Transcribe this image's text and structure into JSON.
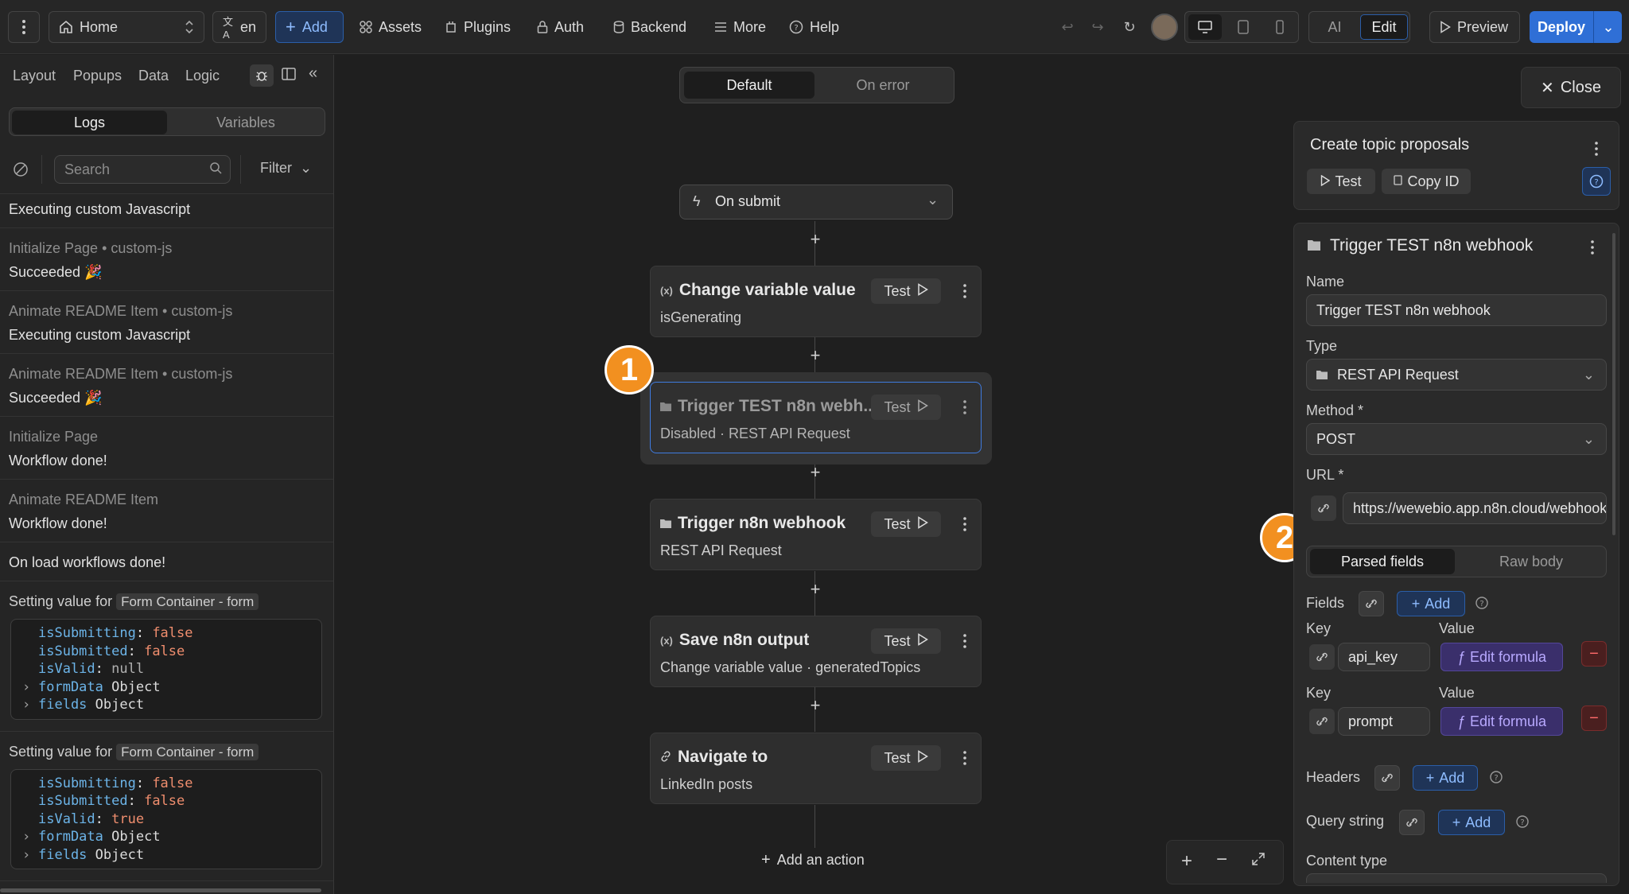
{
  "topbar": {
    "page_select": "Home",
    "lang": "en",
    "add": "Add",
    "nav": [
      "Assets",
      "Plugins",
      "Auth",
      "Backend",
      "More",
      "Help"
    ],
    "mode_ai": "AI",
    "mode_edit": "Edit",
    "preview": "Preview",
    "deploy": "Deploy"
  },
  "left_panel": {
    "tabs": [
      "Layout",
      "Popups",
      "Data",
      "Logic"
    ],
    "seg": [
      "Logs",
      "Variables"
    ],
    "search_placeholder": "Search",
    "filter": "Filter",
    "logs": [
      {
        "title": "",
        "msg": "Executing custom Javascript"
      },
      {
        "title": "Initialize Page • custom-js",
        "msg": "Succeeded 🎉"
      },
      {
        "title": "Animate README Item • custom-js",
        "msg": "Executing custom Javascript"
      },
      {
        "title": "Animate README Item • custom-js",
        "msg": "Succeeded 🎉"
      },
      {
        "title": "Initialize Page",
        "msg": "Workflow done!"
      },
      {
        "title": "Animate README Item",
        "msg": "Workflow done!"
      },
      {
        "title": "",
        "msg": "On load workflows done!"
      }
    ],
    "setting_prefix": "Setting value for",
    "setting_tag": "Form Container - form",
    "state1": {
      "isSubmitting": "false",
      "isSubmitted": "false",
      "isValid": "null",
      "formData": "Object",
      "fields": "Object"
    },
    "state2": {
      "isSubmitting": "false",
      "isSubmitted": "false",
      "isValid": "true",
      "formData": "Object",
      "fields": "Object"
    },
    "keys": {
      "isSubmitting": "isSubmitting",
      "isSubmitted": "isSubmitted",
      "isValid": "isValid",
      "formData": "formData",
      "fields": "fields"
    }
  },
  "canvas": {
    "seg_default": "Default",
    "seg_error": "On error",
    "trigger": "On submit",
    "test_label": "Test",
    "cards": [
      {
        "title": "Change variable value",
        "sub": "isGenerating",
        "icon": "variable-icon"
      },
      {
        "title": "Trigger TEST n8n webh...",
        "sub": "Disabled · REST API Request",
        "icon": "folder-icon"
      },
      {
        "title": "Trigger n8n webhook",
        "sub": "REST API Request",
        "icon": "folder-icon"
      },
      {
        "title": "Save n8n output",
        "sub": "Change variable value · generatedTopics",
        "icon": "variable-icon"
      },
      {
        "title": "Navigate to",
        "sub": "LinkedIn posts",
        "icon": "link-icon"
      }
    ],
    "add_action": "Add an action",
    "badges": [
      "1",
      "2"
    ]
  },
  "right_panel": {
    "close": "Close",
    "workflow_title": "Create topic proposals",
    "test": "Test",
    "copy_id": "Copy ID",
    "action_title": "Trigger TEST n8n webhook",
    "name_label": "Name",
    "name_value": "Trigger TEST n8n webhook",
    "type_label": "Type",
    "type_value": "REST API Request",
    "method_label": "Method",
    "method_value": "POST",
    "url_label": "URL",
    "url_value": "https://wewebio.app.n8n.cloud/webhook",
    "seg_parsed": "Parsed fields",
    "seg_raw": "Raw body",
    "fields_label": "Fields",
    "add": "Add",
    "key_label": "Key",
    "value_label": "Value",
    "field_rows": [
      {
        "key": "api_key",
        "value": "Edit formula"
      },
      {
        "key": "prompt",
        "value": "Edit formula"
      }
    ],
    "headers_label": "Headers",
    "query_label": "Query string",
    "content_type_label": "Content type"
  },
  "colors": {
    "accent": "#2f6fd6",
    "badge": "#f29020",
    "danger": "#ff6b6b",
    "formula": "#b8a9ff"
  }
}
